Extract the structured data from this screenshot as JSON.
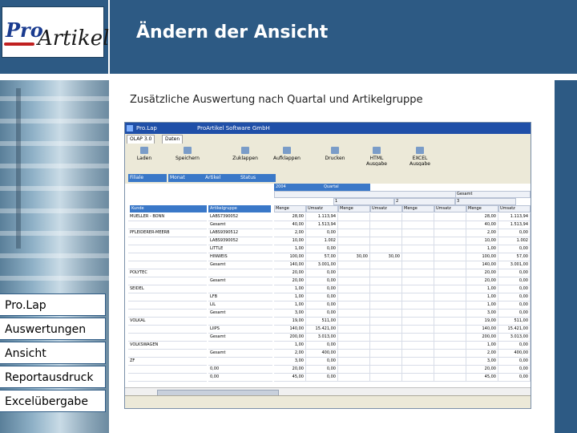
{
  "logo": {
    "pro": "Pro",
    "artikel": "Artikel"
  },
  "header": {
    "title": "Ändern der Ansicht"
  },
  "subtitle": "Zusätzliche Auswertung nach Quartal und Artikelgruppe",
  "nav": {
    "items": [
      {
        "label": "Pro.Lap"
      },
      {
        "label": "Auswertungen"
      },
      {
        "label": "Ansicht"
      },
      {
        "label": "Reportausdruck"
      },
      {
        "label": "Excelübergabe"
      }
    ]
  },
  "app": {
    "title": "Pro.Lap",
    "company": "ProArtikel Software GmbH",
    "tabs": [
      "OLAP 3.0",
      "Daten"
    ],
    "toolbar": [
      "Laden",
      "Speichern",
      "Zuklappen",
      "Aufklappen",
      "Drucken",
      "HTML Ausgabe",
      "EXCEL Ausgabe"
    ],
    "filters": [
      "Filiale",
      "Monat",
      "Artikel",
      "Status"
    ],
    "columns": {
      "year": "2004",
      "quarter_label": "Quartal",
      "row1": "Kunde",
      "row2": "Artikelgruppe",
      "q_headers": [
        "1",
        "2",
        "3",
        "Gesamt"
      ],
      "measures": [
        "Menge",
        "Umsatz"
      ]
    },
    "rows": [
      {
        "kunde": "MUELLER - BONN",
        "gruppe": "LABS7390052",
        "v": [
          "28,00",
          "1.113,94",
          "",
          "",
          "",
          "",
          "28,00",
          "1.113,94",
          "28,00",
          "1.113,94"
        ]
      },
      {
        "kunde": "",
        "gruppe": "Gesamt",
        "v": [
          "40,00",
          "1.513,94",
          "",
          "",
          "",
          "",
          "40,00",
          "1.513,94",
          "40,00",
          "1.513,94"
        ]
      },
      {
        "kunde": "PFLEIDERER-MEERB",
        "gruppe": "LABS9390512",
        "v": [
          "2,00",
          "0,00",
          "",
          "",
          "",
          "",
          "2,00",
          "0,00",
          "2,00",
          "0,00"
        ]
      },
      {
        "kunde": "",
        "gruppe": "LABS9390052",
        "v": [
          "10,00",
          "1.002",
          "",
          "",
          "",
          "",
          "10,00",
          "1.002",
          "10,00",
          "1.002"
        ]
      },
      {
        "kunde": "",
        "gruppe": "LITTLE",
        "v": [
          "1,00",
          "0,00",
          "",
          "",
          "",
          "",
          "1,00",
          "0,00",
          "1,00",
          "0,00"
        ]
      },
      {
        "kunde": "",
        "gruppe": "HINWEIS",
        "v": [
          "100,00",
          "57,00",
          "30,00",
          "30,00",
          "",
          "",
          "100,00",
          "57,00",
          "100,00",
          "57,00"
        ]
      },
      {
        "kunde": "",
        "gruppe": "Gesamt",
        "v": [
          "140,00",
          "3.001,00",
          "",
          "",
          "",
          "",
          "140,00",
          "3.001,00",
          "140,00",
          "3.001,00"
        ]
      },
      {
        "kunde": "POLYTEC",
        "gruppe": "",
        "v": [
          "20,00",
          "0,00",
          "",
          "",
          "",
          "",
          "20,00",
          "0,00",
          "20,00",
          "0,00"
        ]
      },
      {
        "kunde": "",
        "gruppe": "Gesamt",
        "v": [
          "20,00",
          "0,00",
          "",
          "",
          "",
          "",
          "20,00",
          "0,00",
          "20,00",
          "0,00"
        ]
      },
      {
        "kunde": "SEIDEL",
        "gruppe": "",
        "v": [
          "1,00",
          "0,00",
          "",
          "",
          "",
          "",
          "1,00",
          "0,00",
          "1,00",
          "0,00"
        ]
      },
      {
        "kunde": "",
        "gruppe": "LFB",
        "v": [
          "1,00",
          "0,00",
          "",
          "",
          "",
          "",
          "1,00",
          "0,00",
          "1,00",
          "0,00"
        ]
      },
      {
        "kunde": "",
        "gruppe": "LIL",
        "v": [
          "1,00",
          "0,00",
          "",
          "",
          "",
          "",
          "1,00",
          "0,00",
          "1,00",
          "0,00"
        ]
      },
      {
        "kunde": "",
        "gruppe": "Gesamt",
        "v": [
          "3,00",
          "0,00",
          "",
          "",
          "",
          "",
          "3,00",
          "0,00",
          "3,00",
          "0,00"
        ]
      },
      {
        "kunde": "VOLKAL",
        "gruppe": "",
        "v": [
          "19,00",
          "511,00",
          "",
          "",
          "",
          "",
          "19,00",
          "511,00",
          "19,00",
          "511,00"
        ]
      },
      {
        "kunde": "",
        "gruppe": "LIIPS",
        "v": [
          "140,00",
          "15.421,00",
          "",
          "",
          "",
          "",
          "140,00",
          "15.421,00",
          "140,00",
          "15.421,00"
        ]
      },
      {
        "kunde": "",
        "gruppe": "Gesamt",
        "v": [
          "200,00",
          "3.013,00",
          "",
          "",
          "",
          "",
          "200,00",
          "3.013,00",
          "200,00",
          "3.013,00"
        ]
      },
      {
        "kunde": "VOLKSWAGEN",
        "gruppe": "",
        "v": [
          "1,00",
          "0,00",
          "",
          "",
          "",
          "",
          "1,00",
          "0,00",
          "1,00",
          "0,00"
        ]
      },
      {
        "kunde": "",
        "gruppe": "Gesamt",
        "v": [
          "2,00",
          "400,00",
          "",
          "",
          "",
          "",
          "2,00",
          "400,00",
          "2,00",
          "400,00"
        ]
      },
      {
        "kunde": "ZF",
        "gruppe": "",
        "v": [
          "3,00",
          "0,00",
          "",
          "",
          "",
          "",
          "3,00",
          "0,00",
          "3,00",
          "0,00"
        ]
      },
      {
        "kunde": "",
        "gruppe": "0,00",
        "v": [
          "20,00",
          "0,00",
          "",
          "",
          "",
          "",
          "20,00",
          "0,00",
          "20,00",
          "0,00"
        ]
      },
      {
        "kunde": "",
        "gruppe": "0,00",
        "v": [
          "45,00",
          "0,00",
          "",
          "",
          "",
          "",
          "45,00",
          "0,00",
          "45,00",
          "0,00"
        ]
      }
    ]
  }
}
